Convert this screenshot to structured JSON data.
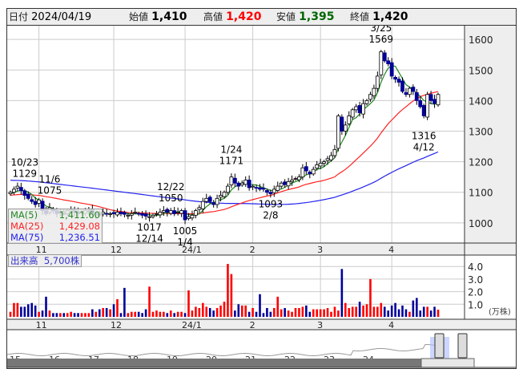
{
  "header": {
    "date_label": "日付",
    "date": "2024/04/19",
    "open_label": "始値",
    "open": "1,410",
    "high_label": "高値",
    "high": "1,420",
    "low_label": "安値",
    "low": "1,395",
    "close_label": "終値",
    "close": "1,420"
  },
  "colors": {
    "up_volume": "#ff0000",
    "down_volume": "#000099",
    "candle_down": "#000099",
    "ma5": "#228822",
    "ma25": "#ff2222",
    "ma75": "#2222ee",
    "high_text": "#ff0000",
    "low_text": "#006600"
  },
  "ma_legend": [
    {
      "name": "MA(5)",
      "value": "1,411.60"
    },
    {
      "name": "MA(25)",
      "value": "1,429.08"
    },
    {
      "name": "MA(75)",
      "value": "1,236.51"
    }
  ],
  "volume_legend": {
    "label": "出来高",
    "value": "5,700株"
  },
  "volume_unit": "(万株)",
  "chart_data": {
    "type": "candlestick",
    "price_axis": {
      "ticks": [
        1000,
        1100,
        1200,
        1300,
        1400,
        1500,
        1600
      ],
      "labels": [
        "1000",
        "1100",
        "1200",
        "1300",
        "1400",
        "1500",
        "1600"
      ],
      "range": [
        934,
        1645
      ]
    },
    "volume_axis": {
      "ticks": [
        1,
        2,
        3,
        4
      ],
      "labels": [
        "1.0",
        "2.0",
        "3.0",
        "4.0"
      ],
      "range": [
        0,
        4.9
      ]
    },
    "month_labels": [
      {
        "index": 8,
        "label": "11"
      },
      {
        "index": 29,
        "label": "12"
      },
      {
        "index": 49,
        "label": "24/1"
      },
      {
        "index": 68,
        "label": "2"
      },
      {
        "index": 87,
        "label": "3"
      },
      {
        "index": 107,
        "label": "4"
      }
    ],
    "close": [
      1100,
      1110,
      1120,
      1105,
      1090,
      1080,
      1070,
      1060,
      1075,
      1040,
      1030,
      1050,
      1040,
      1030,
      1035,
      1030,
      1040,
      1045,
      1035,
      1030,
      1035,
      1040,
      1040,
      1030,
      1030,
      1025,
      1035,
      1030,
      1030,
      1030,
      1035,
      1030,
      1028,
      1025,
      1030,
      1035,
      1030,
      1025,
      1022,
      1020,
      1025,
      1030,
      1035,
      1040,
      1035,
      1040,
      1030,
      1035,
      1040,
      1010,
      1020,
      1025,
      1040,
      1050,
      1070,
      1080,
      1070,
      1060,
      1080,
      1090,
      1100,
      1120,
      1150,
      1130,
      1120,
      1130,
      1140,
      1115,
      1120,
      1115,
      1110,
      1110,
      1100,
      1095,
      1110,
      1120,
      1130,
      1125,
      1135,
      1140,
      1145,
      1150,
      1180,
      1170,
      1160,
      1175,
      1190,
      1195,
      1200,
      1210,
      1220,
      1240,
      1350,
      1300,
      1320,
      1350,
      1370,
      1380,
      1360,
      1390,
      1400,
      1420,
      1440,
      1480,
      1560,
      1530,
      1520,
      1480,
      1470,
      1460,
      1430,
      1420,
      1440,
      1430,
      1400,
      1380,
      1350,
      1420,
      1400,
      1390,
      1420
    ],
    "volume": [
      0.4,
      1.1,
      1.1,
      0.8,
      0.8,
      1.0,
      1.1,
      0.9,
      0.4,
      0.5,
      1.6,
      0.5,
      0.3,
      0.3,
      0.3,
      0.3,
      0.3,
      0.4,
      0.3,
      0.3,
      0.3,
      0.3,
      0.3,
      0.6,
      0.4,
      0.6,
      0.7,
      0.7,
      0.6,
      1.0,
      1.4,
      0.3,
      2.3,
      0.3,
      0.4,
      0.4,
      0.4,
      0.3,
      0.6,
      2.4,
      0.4,
      0.5,
      0.4,
      0.4,
      0.3,
      0.5,
      0.3,
      0.4,
      0.4,
      0.3,
      2.1,
      0.5,
      0.8,
      0.7,
      1.1,
      0.8,
      0.7,
      0.5,
      0.7,
      0.9,
      1.2,
      4.2,
      3.4,
      0.5,
      1.0,
      0.9,
      0.9,
      0.4,
      0.7,
      0.4,
      1.8,
      0.3,
      0.7,
      0.4,
      0.7,
      1.6,
      0.6,
      0.7,
      0.5,
      0.4,
      0.7,
      0.7,
      0.8,
      0.9,
      0.4,
      0.6,
      0.6,
      0.6,
      0.6,
      0.7,
      0.4,
      0.8,
      0.5,
      3.8,
      1.1,
      0.7,
      0.8,
      0.8,
      1.2,
      0.9,
      1.0,
      3.0,
      0.8,
      0.8,
      1.1,
      0.8,
      0.5,
      0.9,
      1.1,
      0.6,
      0.9,
      0.6,
      0.4,
      1.3,
      1.5,
      0.5,
      0.8,
      0.8,
      0.5,
      0.8,
      0.57
    ],
    "annotations": [
      {
        "index": 4,
        "date": "10/23",
        "value": "1129",
        "pos": "above"
      },
      {
        "index": 11,
        "date": "11/6",
        "value": "1075",
        "pos": "above"
      },
      {
        "index": 39,
        "date": "12/14",
        "value": "1017",
        "pos": "below"
      },
      {
        "index": 45,
        "date": "12/22",
        "value": "1050",
        "pos": "above"
      },
      {
        "index": 49,
        "date": "1/4",
        "value": "1005",
        "pos": "below"
      },
      {
        "index": 62,
        "date": "1/24",
        "value": "1171",
        "pos": "above"
      },
      {
        "index": 73,
        "date": "2/8",
        "value": "1093",
        "pos": "below"
      },
      {
        "index": 104,
        "date": "3/25",
        "value": "1569",
        "pos": "above"
      },
      {
        "index": 116,
        "date": "4/12",
        "value": "1316",
        "pos": "below"
      }
    ],
    "navigator_labels": [
      "15",
      "16",
      "17",
      "18",
      "19",
      "20",
      "21",
      "22",
      "23",
      "24"
    ]
  }
}
